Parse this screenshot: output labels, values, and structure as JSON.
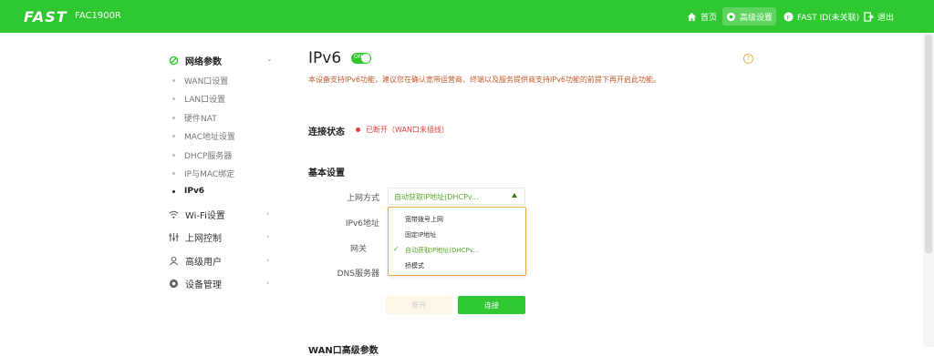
{
  "header": {
    "brand": "FAST",
    "model": "FAC1900R",
    "nav": [
      {
        "label": "首页",
        "icon": "home-icon"
      },
      {
        "label": "高级设置",
        "icon": "settings-icon"
      },
      {
        "label": "FAST ID(未关联)",
        "icon": "fast-id-icon"
      },
      {
        "label": "退出",
        "icon": "logout-icon"
      }
    ]
  },
  "sidebar": {
    "groups": [
      {
        "label": "网络参数",
        "icon": "network-icon",
        "expanded": true
      },
      {
        "label": "Wi-Fi设置",
        "icon": "wifi-icon"
      },
      {
        "label": "上网控制",
        "icon": "control-icon"
      },
      {
        "label": "高级用户",
        "icon": "user-icon"
      },
      {
        "label": "设备管理",
        "icon": "device-icon"
      }
    ],
    "subitems": [
      "WAN口设置",
      "LAN口设置",
      "硬件NAT",
      "MAC地址设置",
      "DHCP服务器",
      "IP与MAC绑定",
      "IPv6"
    ]
  },
  "main": {
    "title": "IPv6",
    "toggle_label": "ON",
    "description": "本设备支持IPv6功能，建议您在确认宽带运营商、终端以及服务提供商支持IPv6功能的前提下再开启此功能。",
    "status_section": "连接状态",
    "status_text": "已断开（WAN口未插线）",
    "basic_section": "基本设置",
    "fields": {
      "mode_label": "上网方式",
      "mode_value": "自动获取IP地址(DHCPv...",
      "ipv6_label": "IPv6地址",
      "gateway_label": "网关",
      "dns_label": "DNS服务器"
    },
    "dropdown_options": [
      "宽带拨号上网",
      "固定IP地址",
      "自动获取IP地址(DHCPv...",
      "桥模式"
    ],
    "selected_option_index": 2,
    "disconnect_button": "断开",
    "connect_button": "连接",
    "next_section": "WAN口高级参数"
  },
  "colors": {
    "brand_green": "#2fc830",
    "status_red": "#e04040",
    "dropdown_border": "#f0a843"
  }
}
